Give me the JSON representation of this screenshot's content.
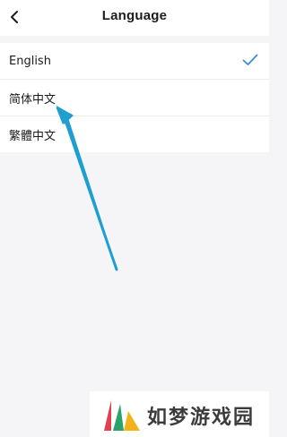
{
  "header": {
    "title": "Language",
    "back_icon": "chevron-left-icon"
  },
  "languages": [
    {
      "label": "English",
      "selected": true
    },
    {
      "label": "简体中文",
      "selected": false
    },
    {
      "label": "繁體中文",
      "selected": false
    }
  ],
  "colors": {
    "accent": "#3d8bd8",
    "arrow": "#1e9fd0",
    "background": "#f5f5f7"
  },
  "watermark": {
    "text": "如梦游戏园"
  }
}
